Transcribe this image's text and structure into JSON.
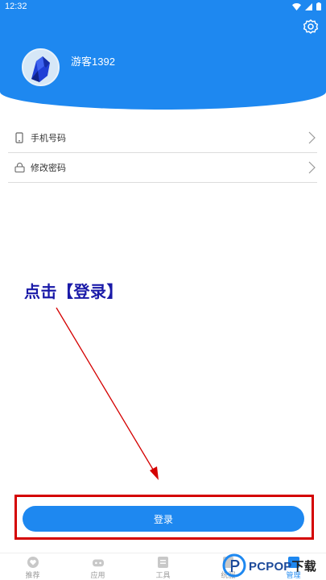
{
  "status_bar": {
    "time": "12:32"
  },
  "profile": {
    "username": "游客1392"
  },
  "menu": {
    "items": [
      {
        "label": "手机号码",
        "icon": "phone-icon"
      },
      {
        "label": "修改密码",
        "icon": "lock-icon"
      }
    ]
  },
  "annotation": {
    "text": "点击【登录】"
  },
  "login": {
    "label": "登录"
  },
  "bottom_nav": {
    "tabs": [
      {
        "label": "推荐",
        "icon": "heart-icon",
        "active": false
      },
      {
        "label": "应用",
        "icon": "apps-icon",
        "active": false
      },
      {
        "label": "工具",
        "icon": "tools-icon",
        "active": false
      },
      {
        "label": "统服",
        "icon": "service-icon",
        "active": false
      },
      {
        "label": "管理",
        "icon": "manage-icon",
        "active": true
      }
    ]
  },
  "watermark": {
    "brand": "PCPOP",
    "suffix": "下载"
  },
  "colors": {
    "primary": "#1e88f0",
    "highlight": "#d40000",
    "annotation": "#1a1aa8"
  }
}
